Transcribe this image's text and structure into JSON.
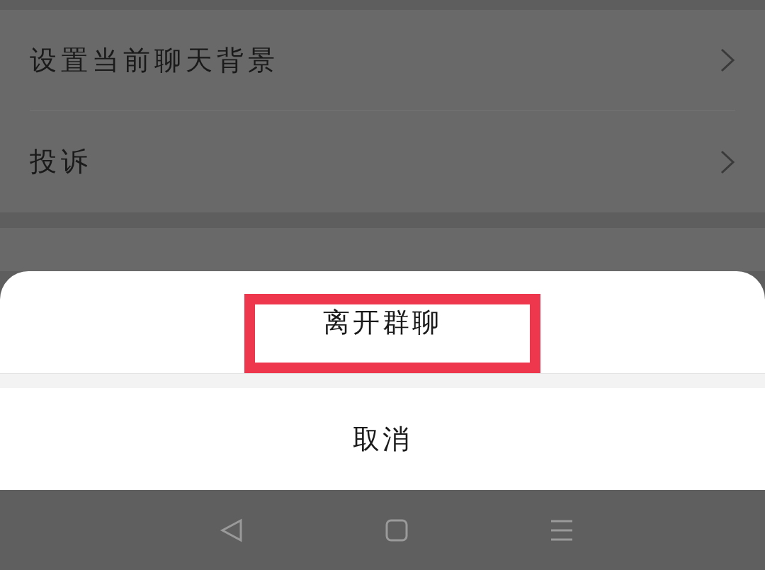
{
  "settings_rows": [
    {
      "label": "设置当前聊天背景"
    },
    {
      "label": "投诉"
    }
  ],
  "action_sheet": {
    "actions": [
      {
        "label": "离开群聊",
        "highlighted": true
      },
      {
        "label": "取消",
        "highlighted": false
      }
    ]
  }
}
